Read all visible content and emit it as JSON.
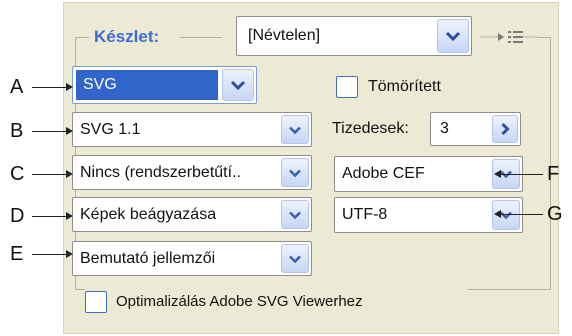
{
  "preset": {
    "label": "Készlet:",
    "value": "[Névtelen]"
  },
  "left_column": {
    "format": "SVG",
    "version": "SVG 1.1",
    "fonts": "Nincs (rendszerbetűtí..",
    "images": "Képek beágyazása",
    "css": "Bemutató jellemzői"
  },
  "compressed_label": "Tömörített",
  "decimals": {
    "label": "Tizedesek:",
    "value": "3"
  },
  "right_column": {
    "font_format": "Adobe CEF",
    "encoding": "UTF-8"
  },
  "optimize_label": "Optimalizálás Adobe SVG Viewerhez",
  "callouts": {
    "a": "A",
    "b": "B",
    "c": "C",
    "d": "D",
    "e": "E",
    "f": "F",
    "g": "G"
  },
  "colors": {
    "panel": "#ece9d4",
    "accent": "#3a6fd1",
    "selection": "#3165c9"
  }
}
